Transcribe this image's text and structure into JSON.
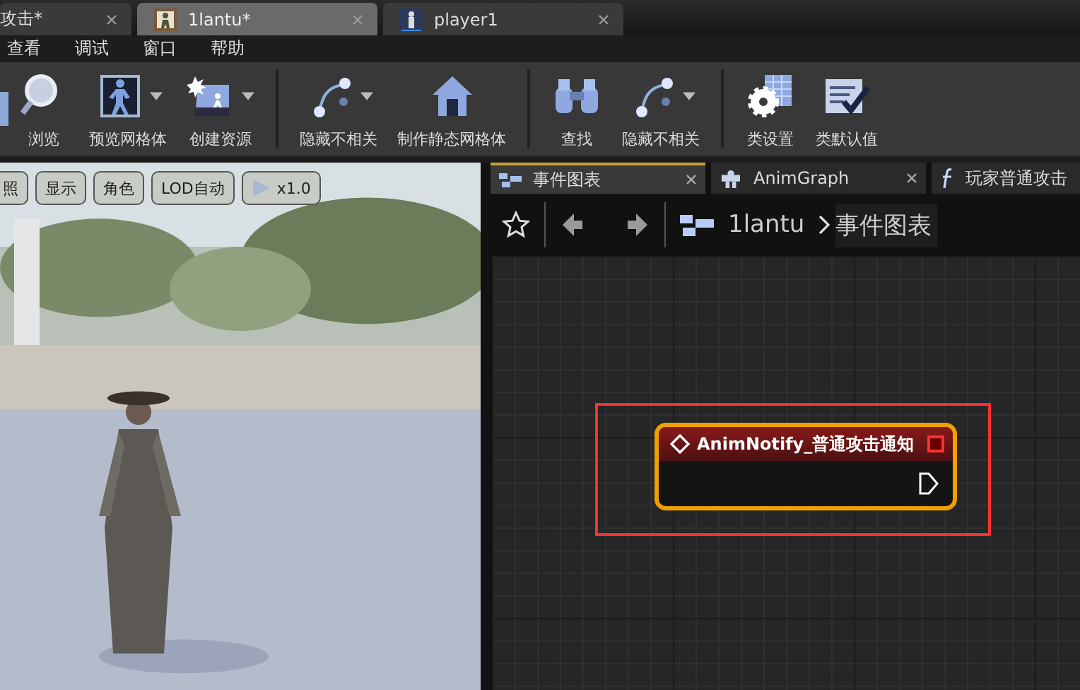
{
  "editor_tabs": [
    {
      "label": "攻击*",
      "kind": "clipped",
      "selected": false
    },
    {
      "label": "1lantu*",
      "kind": "animation",
      "selected": true
    },
    {
      "label": "player1",
      "kind": "character",
      "selected": false
    }
  ],
  "menu": [
    "查看",
    "调试",
    "窗口",
    "帮助"
  ],
  "toolbar": [
    [
      {
        "kind": "clipped"
      },
      {
        "kind": "search",
        "label": "浏览",
        "dropdown": false
      },
      {
        "kind": "mesh",
        "label": "预览网格体",
        "dropdown": true
      },
      {
        "kind": "asset",
        "label": "创建资源",
        "dropdown": true
      }
    ],
    [
      {
        "kind": "hide",
        "label": "隐藏不相关",
        "dropdown": true
      },
      {
        "kind": "house",
        "label": "制作静态网格体",
        "dropdown": false
      }
    ],
    [
      {
        "kind": "binoculars",
        "label": "查找",
        "dropdown": false
      },
      {
        "kind": "hide",
        "label": "隐藏不相关",
        "dropdown": true
      }
    ],
    [
      {
        "kind": "gear",
        "label": "类设置",
        "dropdown": false
      },
      {
        "kind": "checklist",
        "label": "类默认值",
        "dropdown": false
      }
    ]
  ],
  "viewport": {
    "kind": "picture",
    "buttons": [
      {
        "label": "照",
        "kind": "text"
      },
      {
        "label": "显示",
        "kind": "text"
      },
      {
        "label": "角色",
        "kind": "text"
      },
      {
        "label": "LOD自动",
        "kind": "text"
      },
      {
        "label": "x1.0",
        "kind": "speed"
      }
    ]
  },
  "graph_tabs": [
    {
      "label": "事件图表",
      "kind": "graph",
      "selected": true,
      "closable": true
    },
    {
      "label": "AnimGraph",
      "kind": "anim",
      "selected": false,
      "closable": true
    },
    {
      "label": "玩家普通攻击",
      "kind": "function",
      "selected": false
    }
  ],
  "breadcrumb": [
    "1lantu",
    "事件图表"
  ],
  "node": {
    "title": "AnimNotify_普通攻击通知",
    "highlighted": true
  }
}
